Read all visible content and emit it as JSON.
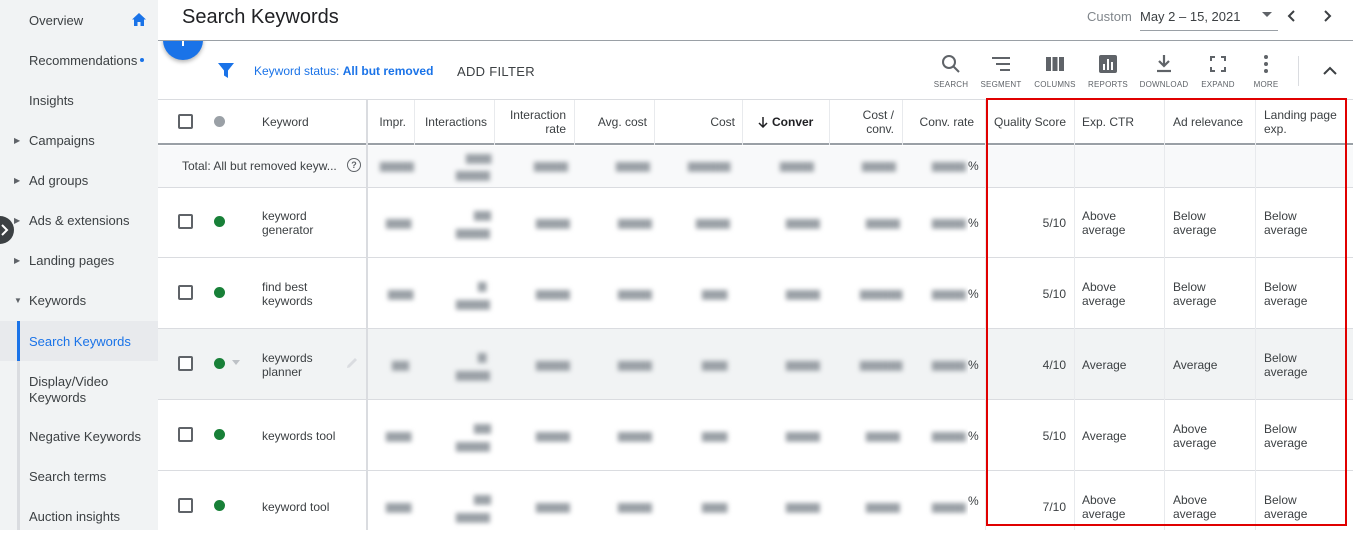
{
  "sidebar": {
    "items": [
      {
        "label": "Overview"
      },
      {
        "label": "Recommendations"
      },
      {
        "label": "Insights"
      },
      {
        "label": "Campaigns"
      },
      {
        "label": "Ad groups"
      },
      {
        "label": "Ads & extensions"
      },
      {
        "label": "Landing pages"
      },
      {
        "label": "Keywords"
      },
      {
        "label": "Search Keywords"
      },
      {
        "label_line1": "Display/Video",
        "label_line2": "Keywords"
      },
      {
        "label": "Negative Keywords"
      },
      {
        "label": "Search terms"
      },
      {
        "label": "Auction insights"
      }
    ]
  },
  "header": {
    "title": "Search Keywords",
    "date_label": "Custom",
    "date_range": "May 2 – 15, 2021"
  },
  "filter": {
    "prefix": "Keyword status: ",
    "value": "All but removed",
    "add_filter": "ADD FILTER"
  },
  "toolbar": {
    "search": "SEARCH",
    "segment": "SEGMENT",
    "columns": "COLUMNS",
    "reports": "REPORTS",
    "download": "DOWNLOAD",
    "expand": "EXPAND",
    "more": "MORE"
  },
  "table": {
    "headers": {
      "keyword": "Keyword",
      "impr": "Impr.",
      "interactions": "Interactions",
      "interaction_rate_1": "Interaction",
      "interaction_rate_2": "rate",
      "avg_cost": "Avg. cost",
      "cost": "Cost",
      "conversions": "Conver",
      "cost_conv_1": "Cost /",
      "cost_conv_2": "conv.",
      "conv_rate": "Conv. rate",
      "quality_score": "Quality Score",
      "exp_ctr": "Exp. CTR",
      "ad_relevance": "Ad relevance",
      "landing_1": "Landing page",
      "landing_2": "exp."
    },
    "total_label": "Total: All but removed keyw...",
    "total_conv_rate_suffix": "%",
    "rows": [
      {
        "kw1": "keyword",
        "kw2": "generator",
        "qs": "5/10",
        "ctr1": "Above",
        "ctr2": "average",
        "rel1": "Below",
        "rel2": "average",
        "lp1": "Below",
        "lp2": "average",
        "pct": "%"
      },
      {
        "kw1": "find best",
        "kw2": "keywords",
        "qs": "5/10",
        "ctr1": "Above",
        "ctr2": "average",
        "rel1": "Below",
        "rel2": "average",
        "lp1": "Below",
        "lp2": "average",
        "pct": "%"
      },
      {
        "kw1": "keywords",
        "kw2": "planner",
        "qs": "4/10",
        "ctr1": "Average",
        "ctr2": "",
        "rel1": "Average",
        "rel2": "",
        "lp1": "Below",
        "lp2": "average",
        "pct": "%"
      },
      {
        "kw1": "keywords tool",
        "kw2": "",
        "qs": "5/10",
        "ctr1": "Average",
        "ctr2": "",
        "rel1": "Above",
        "rel2": "average",
        "lp1": "Below",
        "lp2": "average",
        "pct": "%"
      },
      {
        "kw1": "keyword tool",
        "kw2": "",
        "qs": "7/10",
        "ctr1": "Above",
        "ctr2": "average",
        "rel1": "Above",
        "rel2": "average",
        "lp1": "Below",
        "lp2": "average",
        "pct": "%"
      }
    ]
  },
  "colors": {
    "accent": "#1a73e8",
    "status_enabled": "#188038",
    "highlight_box": "#e00000"
  }
}
